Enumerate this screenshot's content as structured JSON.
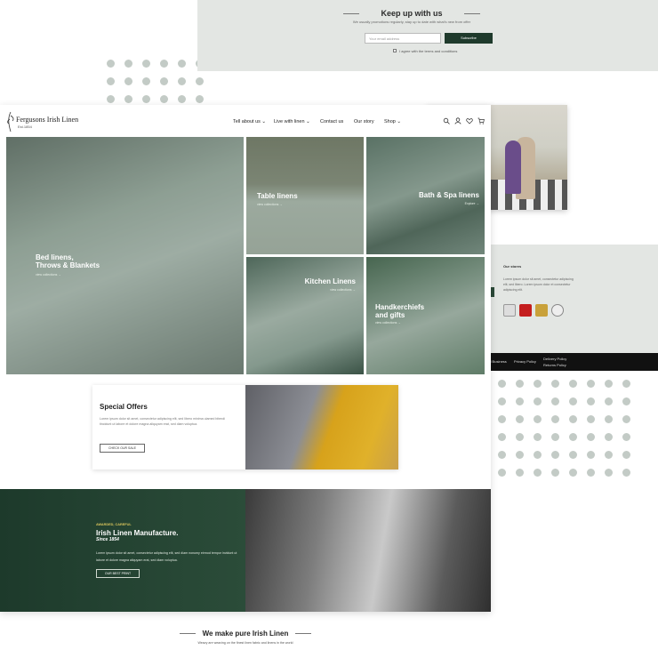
{
  "newsletter": {
    "title": "Keep up with us",
    "subtitle": "We usually promotions regularly, stay up to date with what's new from offer",
    "email_placeholder": "Your email address",
    "subscribe_label": "Subscribe",
    "terms_text": "I agree with the terms and conditions"
  },
  "footer": {
    "heading": "Our stores",
    "text": "Lorem ipsum dolor sit amet, consectetur adipiscing elit, sed libero. Lorem ipsum dolor et consectetur adipiscing elit.",
    "links": [
      "ed Business",
      "Privacy Policy",
      "Delivery Policy",
      "Returns Policy"
    ]
  },
  "header": {
    "logo_name": "Fergusons Irish Linen",
    "logo_est": "Est.1854",
    "nav": [
      "Tell about us",
      "Live with linen",
      "Contact us",
      "Our story",
      "Shop"
    ]
  },
  "hero": {
    "bed": {
      "title_line1": "Bed linens,",
      "title_line2": "Throws & Blankets",
      "cta": "view collections"
    },
    "table": {
      "title": "Table linens",
      "cta": "view collections"
    },
    "bath": {
      "title": "Bath & Spa linens",
      "cta": "Explore"
    },
    "kitchen": {
      "title": "Kitchen Linens",
      "cta": "view collections"
    },
    "hand": {
      "title_line1": "Handkerchiefs",
      "title_line2": "and gifts",
      "cta": "view collections"
    }
  },
  "offers": {
    "title": "Special Offers",
    "text": "Lorem ipsum dolor sit amet, consectetur adipiscing elit, sed libero minima ulamed bitendi tincidunt ut labore et dolore magna aliquyam erat, sed diam voluptua.",
    "button": "CHECK OUR SALE"
  },
  "manufacture": {
    "kicker": "AWARDED, CAREFUL",
    "title": "Irish Linen Manufacture.",
    "since": "Since 1854",
    "text": "Lorem ipsum dolor sit amet, consectetur adipiscing elit, sed diam nonumy eirmod tempor invidunt ut labore et dolore magna aliquyam erat, sed diam voluptua.",
    "button": "OUR BEST PRINT"
  },
  "bottom": {
    "title": "We make pure Irish Linen",
    "subtitle": "Weavy are weaving on the finest linen fabric and linens in the world"
  },
  "colors": {
    "brand_green": "#1f3a2c",
    "panel_grey": "#e3e6e3",
    "dot": "#c3cbc6",
    "gold": "#d8c45c"
  },
  "icons": [
    "search-icon",
    "user-icon",
    "heart-icon",
    "cart-icon",
    "logo-icon"
  ],
  "badges": {
    "wishlist_count": "0",
    "cart_count": "0"
  }
}
